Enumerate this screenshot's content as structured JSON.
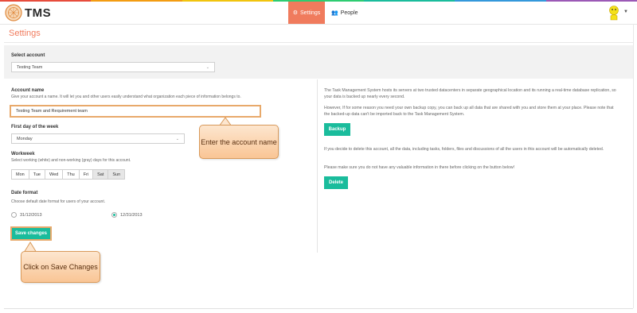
{
  "app": {
    "logo_text": "TMS"
  },
  "nav": {
    "settings_label": "Settings",
    "people_label": "People"
  },
  "page": {
    "title": "Settings"
  },
  "select_account": {
    "label": "Select account",
    "value": "Testing Team"
  },
  "account_name": {
    "label": "Account name",
    "help": "Give your account a name. It will let you and other users easily understand what organization each piece of information belongs to.",
    "value": "Testing Team and Requirement team"
  },
  "first_day": {
    "label": "First day of the week",
    "value": "Monday"
  },
  "workweek": {
    "label": "Workweek",
    "help": "Select working (white) and non-working (gray) days for this account.",
    "days": [
      {
        "label": "Mon",
        "working": true
      },
      {
        "label": "Tue",
        "working": true
      },
      {
        "label": "Wed",
        "working": true
      },
      {
        "label": "Thu",
        "working": true
      },
      {
        "label": "Fri",
        "working": true
      },
      {
        "label": "Sat",
        "working": false
      },
      {
        "label": "Sun",
        "working": false
      }
    ]
  },
  "date_format": {
    "label": "Date format",
    "help": "Choose default date format for users of your account.",
    "option1": "31/12/2013",
    "option2": "12/31/2013",
    "selected": "12/31/2013"
  },
  "save_label": "Save changes",
  "right": {
    "para1": "The Task Management System hosts its servers at two trusted datacenters in separate geographical location and its running a real-time database replication, so your data is backed up nearly every second.",
    "para2": "However, If for some reason you need your own backup copy, you can back up all data that are shared with you and store them at your place. Please note that the backed-up data can't be imported back to the Task Management System.",
    "backup_label": "Backup",
    "para3": "If you decide to delete this account, all the data, including tasks, folders, files and discussions of all the users in this account will be automatically deleted.",
    "para4": "Please make sure you do not have any valuable information in there before clicking on the button below!",
    "delete_label": "Delete"
  },
  "callouts": {
    "enter_name": "Enter the account name",
    "click_save": "Click on Save Changes"
  },
  "colors": {
    "accent": "#f07b5d",
    "green": "#1abc9c",
    "highlight": "#e8a96b"
  }
}
